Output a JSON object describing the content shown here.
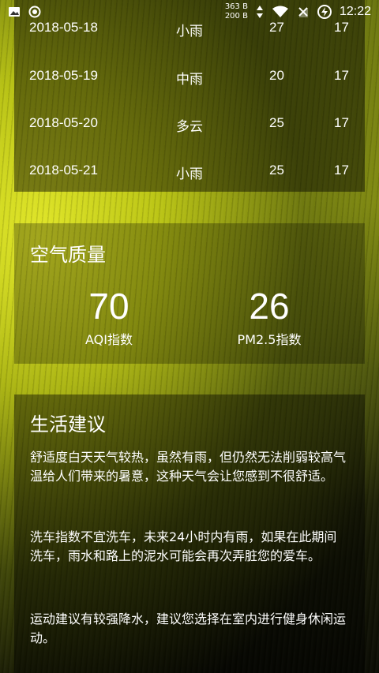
{
  "status_bar": {
    "upload_speed": "363 B",
    "download_speed": "200 B",
    "time": "12:22",
    "icons": [
      "image-icon",
      "record-icon",
      "wifi-icon",
      "no-sim-icon",
      "battery-charging-icon"
    ]
  },
  "forecast": {
    "rows": [
      {
        "date": "2018-05-18",
        "weather": "小雨",
        "max": "27",
        "min": "17"
      },
      {
        "date": "2018-05-19",
        "weather": "中雨",
        "max": "20",
        "min": "17"
      },
      {
        "date": "2018-05-20",
        "weather": "多云",
        "max": "25",
        "min": "17"
      },
      {
        "date": "2018-05-21",
        "weather": "小雨",
        "max": "25",
        "min": "17"
      }
    ]
  },
  "air_quality": {
    "title": "空气质量",
    "aqi_value": "70",
    "aqi_label": "AQI指数",
    "pm25_value": "26",
    "pm25_label": "PM2.5指数"
  },
  "suggestions": {
    "title": "生活建议",
    "comfort": "舒适度白天天气较热，虽然有雨，但仍然无法削弱较高气温给人们带来的暑意，这种天气会让您感到不很舒适。",
    "car_wash": "洗车指数不宜洗车，未来24小时内有雨，如果在此期间洗车，雨水和路上的泥水可能会再次弄脏您的爱车。",
    "sport": "运动建议有较强降水，建议您选择在室内进行健身休闲运动。"
  }
}
